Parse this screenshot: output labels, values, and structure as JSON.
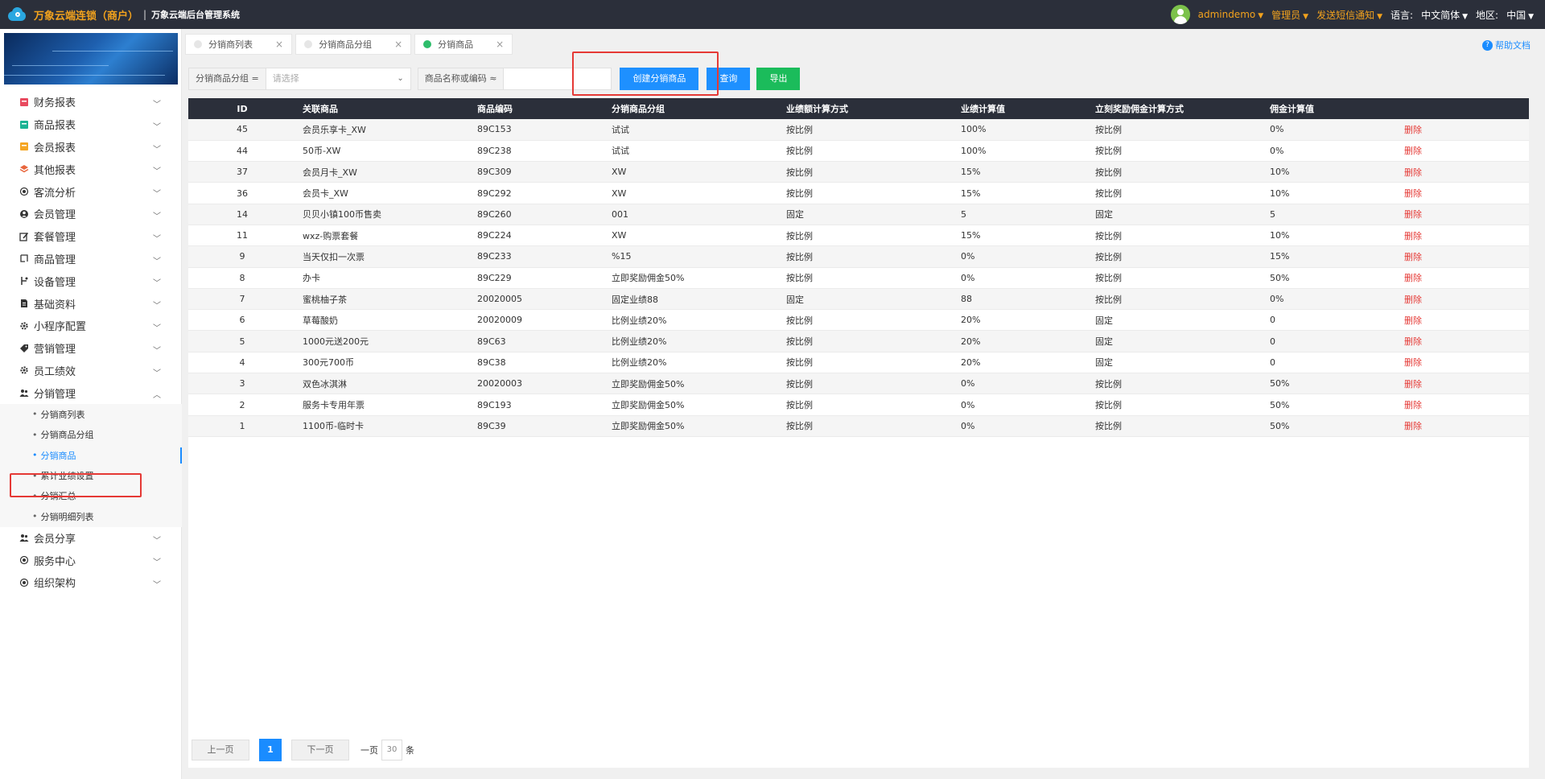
{
  "topbar": {
    "brand": "万象云端连锁（商户）",
    "separator": "|",
    "subtitle": "万象云端后台管理系统",
    "username": "admindemo",
    "role": "管理员",
    "sms": "发送短信通知",
    "lang_label": "语言:",
    "lang_value": "中文简体",
    "region_label": "地区:",
    "region_value": "中国"
  },
  "sidebar": {
    "menu": [
      {
        "label": "财务报表",
        "icon": "finance-report-icon",
        "color": "#e84a5f"
      },
      {
        "label": "商品报表",
        "icon": "goods-report-icon",
        "color": "#1bb394"
      },
      {
        "label": "会员报表",
        "icon": "member-report-icon",
        "color": "#f5a623"
      },
      {
        "label": "其他报表",
        "icon": "layers-icon",
        "color": "#e8663d"
      },
      {
        "label": "客流分析",
        "icon": "target-icon",
        "color": "#333333"
      },
      {
        "label": "会员管理",
        "icon": "user-icon",
        "color": "#333333"
      },
      {
        "label": "套餐管理",
        "icon": "edit-icon",
        "color": "#333333"
      },
      {
        "label": "商品管理",
        "icon": "goods-icon",
        "color": "#333333"
      },
      {
        "label": "设备管理",
        "icon": "device-icon",
        "color": "#333333"
      },
      {
        "label": "基础资料",
        "icon": "document-icon",
        "color": "#333333"
      },
      {
        "label": "小程序配置",
        "icon": "gear-icon",
        "color": "#333333"
      },
      {
        "label": "营销管理",
        "icon": "tag-icon",
        "color": "#333333"
      },
      {
        "label": "员工绩效",
        "icon": "gear-icon",
        "color": "#333333"
      },
      {
        "label": "分销管理",
        "icon": "users-icon",
        "color": "#333333"
      }
    ],
    "submenu": [
      "分销商列表",
      "分销商品分组",
      "分销商品",
      "累计业绩设置",
      "分销汇总",
      "分销明细列表"
    ],
    "menu_after": [
      {
        "label": "会员分享",
        "icon": "users-icon",
        "color": "#333333"
      },
      {
        "label": "服务中心",
        "icon": "target-icon",
        "color": "#333333"
      },
      {
        "label": "组织架构",
        "icon": "target-icon",
        "color": "#333333"
      }
    ]
  },
  "tabs": [
    {
      "label": "分销商列表",
      "close": "×"
    },
    {
      "label": "分销商品分组",
      "close": "×"
    },
    {
      "label": "分销商品",
      "close": "×"
    }
  ],
  "help": {
    "label": "帮助文档",
    "icon_char": "?"
  },
  "toolbar": {
    "group_label": "分销商品分组 =",
    "group_placeholder": "请选择",
    "search_label": "商品名称或编码 ≈",
    "create_button": "创建分销商品",
    "query_button": "查询",
    "export_button": "导出"
  },
  "table": {
    "headers": [
      "ID",
      "关联商品",
      "商品编码",
      "分销商品分组",
      "业绩额计算方式",
      "业绩计算值",
      "立刻奖励佣金计算方式",
      "佣金计算值",
      ""
    ],
    "rows": [
      [
        "45",
        "会员乐享卡_XW",
        "89C153",
        "试试",
        "按比例",
        "100%",
        "按比例",
        "0%",
        "删除"
      ],
      [
        "44",
        "50币-XW",
        "89C238",
        "试试",
        "按比例",
        "100%",
        "按比例",
        "0%",
        "删除"
      ],
      [
        "37",
        "会员月卡_XW",
        "89C309",
        "XW",
        "按比例",
        "15%",
        "按比例",
        "10%",
        "删除"
      ],
      [
        "36",
        "会员卡_XW",
        "89C292",
        "XW",
        "按比例",
        "15%",
        "按比例",
        "10%",
        "删除"
      ],
      [
        "14",
        "贝贝小镇100币售卖",
        "89C260",
        "001",
        "固定",
        "5",
        "固定",
        "5",
        "删除"
      ],
      [
        "11",
        "wxz-购票套餐",
        "89C224",
        "XW",
        "按比例",
        "15%",
        "按比例",
        "10%",
        "删除"
      ],
      [
        "9",
        "当天仅扣一次票",
        "89C233",
        "%15",
        "按比例",
        "0%",
        "按比例",
        "15%",
        "删除"
      ],
      [
        "8",
        "办卡",
        "89C229",
        "立即奖励佣金50%",
        "按比例",
        "0%",
        "按比例",
        "50%",
        "删除"
      ],
      [
        "7",
        "蜜桃柚子茶",
        "20020005",
        "固定业绩88",
        "固定",
        "88",
        "按比例",
        "0%",
        "删除"
      ],
      [
        "6",
        "草莓酸奶",
        "20020009",
        "比例业绩20%",
        "按比例",
        "20%",
        "固定",
        "0",
        "删除"
      ],
      [
        "5",
        "1000元送200元",
        "89C63",
        "比例业绩20%",
        "按比例",
        "20%",
        "固定",
        "0",
        "删除"
      ],
      [
        "4",
        "300元700币",
        "89C38",
        "比例业绩20%",
        "按比例",
        "20%",
        "固定",
        "0",
        "删除"
      ],
      [
        "3",
        "双色冰淇淋",
        "20020003",
        "立即奖励佣金50%",
        "按比例",
        "0%",
        "按比例",
        "50%",
        "删除"
      ],
      [
        "2",
        "服务卡专用年票",
        "89C193",
        "立即奖励佣金50%",
        "按比例",
        "0%",
        "按比例",
        "50%",
        "删除"
      ],
      [
        "1",
        "1100币-临时卡",
        "89C39",
        "立即奖励佣金50%",
        "按比例",
        "0%",
        "按比例",
        "50%",
        "删除"
      ]
    ]
  },
  "pager": {
    "prev": "上一页",
    "current": "1",
    "next": "下一页",
    "per_page_label": "一页",
    "per_page_value": "30",
    "per_page_unit": "条"
  }
}
